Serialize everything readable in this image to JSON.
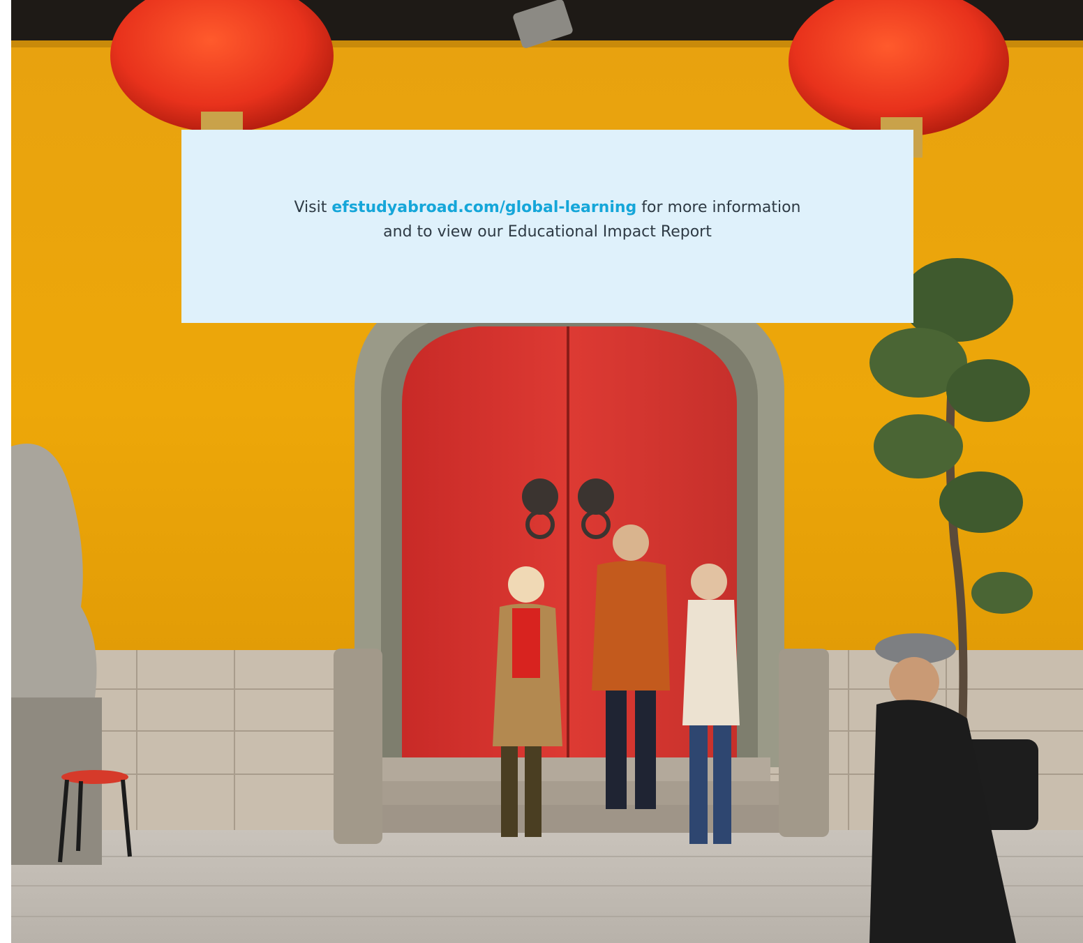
{
  "info": {
    "line1_prefix": "Visit",
    "link_text": "efstudyabroad.com/global-learning",
    "line1_suffix": "for more information",
    "line2": "and to view our Educational Impact Report"
  },
  "colors": {
    "panel_background": "#dff1fb",
    "link": "#15a6d9",
    "body_text": "#2e3a44",
    "wall": "#eba40c",
    "door": "#d6322e",
    "lantern": "#e8321c"
  }
}
